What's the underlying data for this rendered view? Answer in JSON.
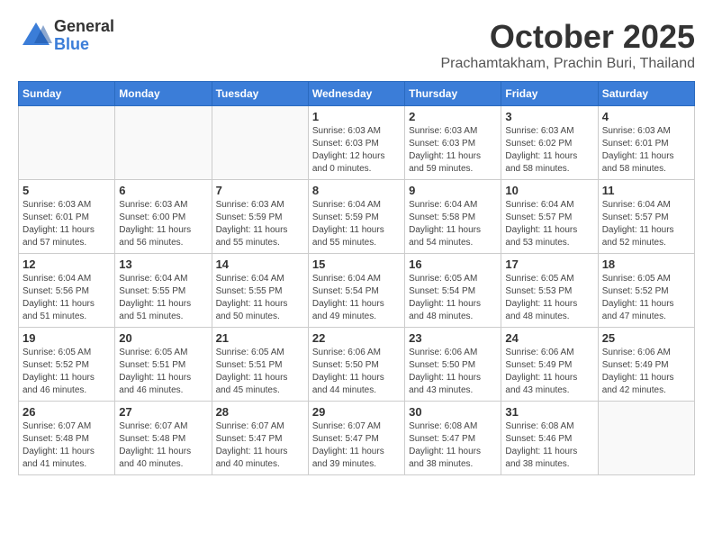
{
  "header": {
    "logo_general": "General",
    "logo_blue": "Blue",
    "month": "October 2025",
    "location": "Prachamtakham, Prachin Buri, Thailand"
  },
  "weekdays": [
    "Sunday",
    "Monday",
    "Tuesday",
    "Wednesday",
    "Thursday",
    "Friday",
    "Saturday"
  ],
  "weeks": [
    [
      {
        "day": "",
        "info": ""
      },
      {
        "day": "",
        "info": ""
      },
      {
        "day": "",
        "info": ""
      },
      {
        "day": "1",
        "info": "Sunrise: 6:03 AM\nSunset: 6:03 PM\nDaylight: 12 hours\nand 0 minutes."
      },
      {
        "day": "2",
        "info": "Sunrise: 6:03 AM\nSunset: 6:03 PM\nDaylight: 11 hours\nand 59 minutes."
      },
      {
        "day": "3",
        "info": "Sunrise: 6:03 AM\nSunset: 6:02 PM\nDaylight: 11 hours\nand 58 minutes."
      },
      {
        "day": "4",
        "info": "Sunrise: 6:03 AM\nSunset: 6:01 PM\nDaylight: 11 hours\nand 58 minutes."
      }
    ],
    [
      {
        "day": "5",
        "info": "Sunrise: 6:03 AM\nSunset: 6:01 PM\nDaylight: 11 hours\nand 57 minutes."
      },
      {
        "day": "6",
        "info": "Sunrise: 6:03 AM\nSunset: 6:00 PM\nDaylight: 11 hours\nand 56 minutes."
      },
      {
        "day": "7",
        "info": "Sunrise: 6:03 AM\nSunset: 5:59 PM\nDaylight: 11 hours\nand 55 minutes."
      },
      {
        "day": "8",
        "info": "Sunrise: 6:04 AM\nSunset: 5:59 PM\nDaylight: 11 hours\nand 55 minutes."
      },
      {
        "day": "9",
        "info": "Sunrise: 6:04 AM\nSunset: 5:58 PM\nDaylight: 11 hours\nand 54 minutes."
      },
      {
        "day": "10",
        "info": "Sunrise: 6:04 AM\nSunset: 5:57 PM\nDaylight: 11 hours\nand 53 minutes."
      },
      {
        "day": "11",
        "info": "Sunrise: 6:04 AM\nSunset: 5:57 PM\nDaylight: 11 hours\nand 52 minutes."
      }
    ],
    [
      {
        "day": "12",
        "info": "Sunrise: 6:04 AM\nSunset: 5:56 PM\nDaylight: 11 hours\nand 51 minutes."
      },
      {
        "day": "13",
        "info": "Sunrise: 6:04 AM\nSunset: 5:55 PM\nDaylight: 11 hours\nand 51 minutes."
      },
      {
        "day": "14",
        "info": "Sunrise: 6:04 AM\nSunset: 5:55 PM\nDaylight: 11 hours\nand 50 minutes."
      },
      {
        "day": "15",
        "info": "Sunrise: 6:04 AM\nSunset: 5:54 PM\nDaylight: 11 hours\nand 49 minutes."
      },
      {
        "day": "16",
        "info": "Sunrise: 6:05 AM\nSunset: 5:54 PM\nDaylight: 11 hours\nand 48 minutes."
      },
      {
        "day": "17",
        "info": "Sunrise: 6:05 AM\nSunset: 5:53 PM\nDaylight: 11 hours\nand 48 minutes."
      },
      {
        "day": "18",
        "info": "Sunrise: 6:05 AM\nSunset: 5:52 PM\nDaylight: 11 hours\nand 47 minutes."
      }
    ],
    [
      {
        "day": "19",
        "info": "Sunrise: 6:05 AM\nSunset: 5:52 PM\nDaylight: 11 hours\nand 46 minutes."
      },
      {
        "day": "20",
        "info": "Sunrise: 6:05 AM\nSunset: 5:51 PM\nDaylight: 11 hours\nand 46 minutes."
      },
      {
        "day": "21",
        "info": "Sunrise: 6:05 AM\nSunset: 5:51 PM\nDaylight: 11 hours\nand 45 minutes."
      },
      {
        "day": "22",
        "info": "Sunrise: 6:06 AM\nSunset: 5:50 PM\nDaylight: 11 hours\nand 44 minutes."
      },
      {
        "day": "23",
        "info": "Sunrise: 6:06 AM\nSunset: 5:50 PM\nDaylight: 11 hours\nand 43 minutes."
      },
      {
        "day": "24",
        "info": "Sunrise: 6:06 AM\nSunset: 5:49 PM\nDaylight: 11 hours\nand 43 minutes."
      },
      {
        "day": "25",
        "info": "Sunrise: 6:06 AM\nSunset: 5:49 PM\nDaylight: 11 hours\nand 42 minutes."
      }
    ],
    [
      {
        "day": "26",
        "info": "Sunrise: 6:07 AM\nSunset: 5:48 PM\nDaylight: 11 hours\nand 41 minutes."
      },
      {
        "day": "27",
        "info": "Sunrise: 6:07 AM\nSunset: 5:48 PM\nDaylight: 11 hours\nand 40 minutes."
      },
      {
        "day": "28",
        "info": "Sunrise: 6:07 AM\nSunset: 5:47 PM\nDaylight: 11 hours\nand 40 minutes."
      },
      {
        "day": "29",
        "info": "Sunrise: 6:07 AM\nSunset: 5:47 PM\nDaylight: 11 hours\nand 39 minutes."
      },
      {
        "day": "30",
        "info": "Sunrise: 6:08 AM\nSunset: 5:47 PM\nDaylight: 11 hours\nand 38 minutes."
      },
      {
        "day": "31",
        "info": "Sunrise: 6:08 AM\nSunset: 5:46 PM\nDaylight: 11 hours\nand 38 minutes."
      },
      {
        "day": "",
        "info": ""
      }
    ]
  ]
}
